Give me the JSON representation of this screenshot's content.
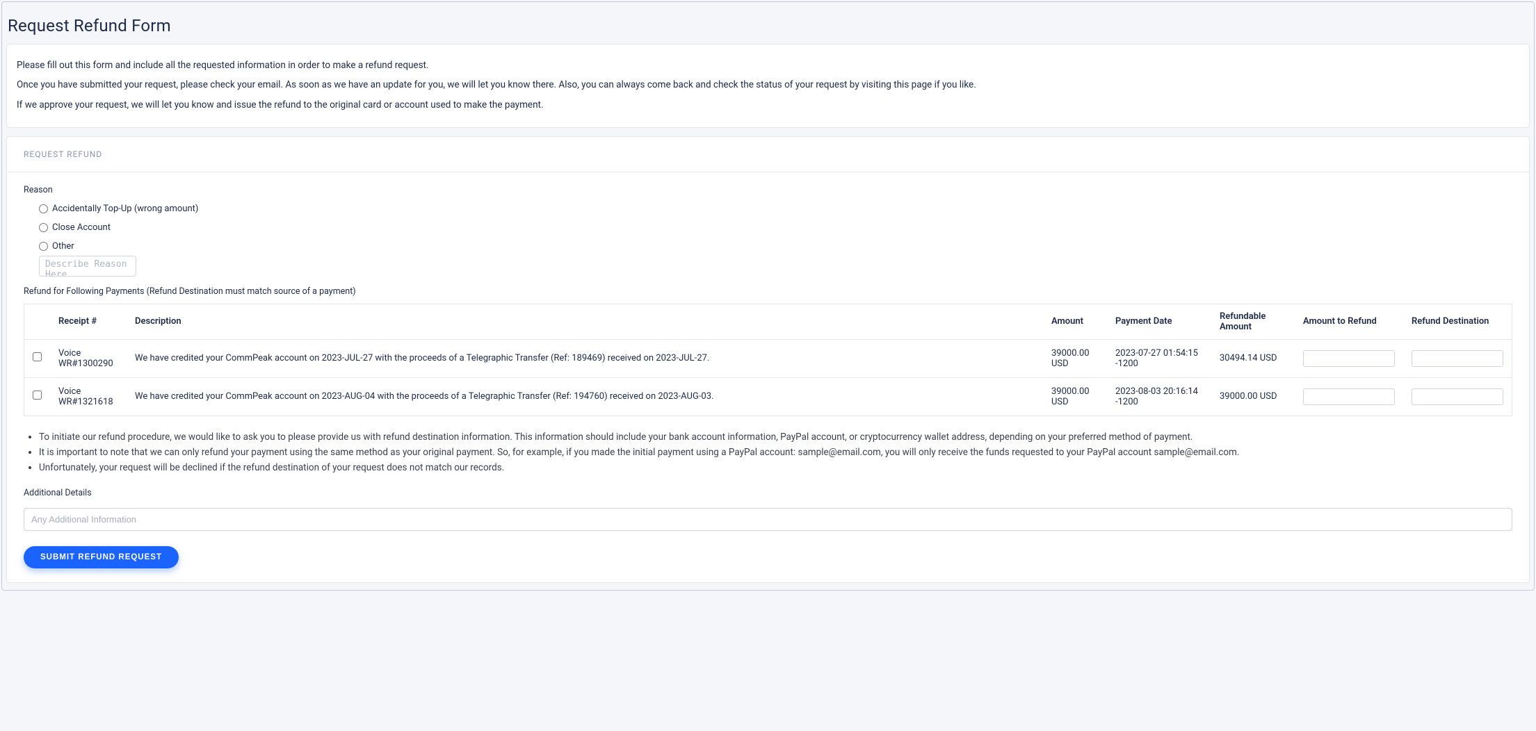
{
  "page": {
    "title": "Request Refund Form"
  },
  "info": {
    "p1": "Please fill out this form and include all the requested information in order to make a refund request.",
    "p2": "Once you have submitted your request, please check your email. As soon as we have an update for you, we will let you know there. Also, you can always come back and check the status of your request by visiting this page if you like.",
    "p3": "If we approve your request, we will let you know and issue the refund to the original card or account used to make the payment."
  },
  "form": {
    "section_header": "Request Refund",
    "reason_label": "Reason",
    "reason_options": {
      "opt1": "Accidentally Top-Up (wrong amount)",
      "opt2": "Close Account",
      "opt3": "Other"
    },
    "reason_textarea_placeholder": "Describe Reason Here",
    "payments_label": "Refund for Following Payments (Refund Destination must match source of a payment)",
    "table": {
      "headers": {
        "receipt": "Receipt #",
        "description": "Description",
        "amount": "Amount",
        "payment_date": "Payment Date",
        "refundable": "Refundable Amount",
        "amount_to_refund": "Amount to Refund",
        "refund_destination": "Refund Destination"
      },
      "rows": [
        {
          "receipt": "Voice WR#1300290",
          "description": "We have credited your CommPeak account on 2023-JUL-27 with the proceeds of a Telegraphic Transfer (Ref: 189469) received on 2023-JUL-27.",
          "amount": "39000.00 USD",
          "payment_date": "2023-07-27 01:54:15 -1200",
          "refundable": "30494.14 USD",
          "amount_to_refund": "",
          "refund_destination": ""
        },
        {
          "receipt": "Voice WR#1321618",
          "description": "We have credited your CommPeak account on 2023-AUG-04 with the proceeds of a Telegraphic Transfer (Ref: 194760) received on 2023-AUG-03.",
          "amount": "39000.00 USD",
          "payment_date": "2023-08-03 20:16:14 -1200",
          "refundable": "39000.00 USD",
          "amount_to_refund": "",
          "refund_destination": ""
        }
      ]
    },
    "notes": {
      "n1": "To initiate our refund procedure, we would like to ask you to please provide us with refund destination information. This information should include your bank account information, PayPal account, or cryptocurrency wallet address, depending on your preferred method of payment.",
      "n2": "It is important to note that we can only refund your payment using the same method as your original payment. So, for example, if you made the initial payment using a PayPal account: sample@email.com, you will only receive the funds requested to your PayPal account sample@email.com.",
      "n3": "Unfortunately, your request will be declined if the refund destination of your request does not match our records."
    },
    "additional_details_label": "Additional Details",
    "additional_details_placeholder": "Any Additional Information",
    "submit_label": "Submit Refund Request"
  }
}
